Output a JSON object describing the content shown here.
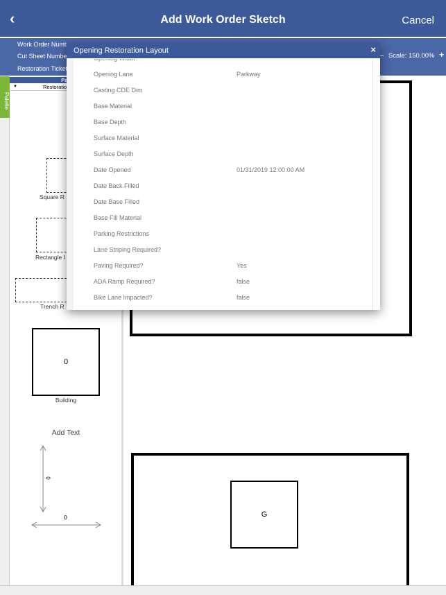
{
  "header": {
    "back_icon": "chevron-left-icon",
    "back": "‹",
    "title": "Add Work Order Sketch",
    "cancel": "Cancel"
  },
  "info": {
    "work_order_label": "Work Order Numb",
    "cut_sheet_label": "Cut Sheet Numbe",
    "restoration_ticket_label": "Restoration Ticket",
    "scale_minus": "–",
    "scale": "Scale: 150.00%",
    "scale_plus": "+"
  },
  "palette": {
    "tab": "Palette",
    "header": "Pale",
    "dropdown": "Restoratio",
    "items": [
      {
        "label": "Square R"
      },
      {
        "label": "Rectangle I"
      },
      {
        "label": "Trench R"
      },
      {
        "label": "Building",
        "value": "0"
      }
    ],
    "add_text": "Add Text",
    "vertical_dim": "0",
    "horizontal_dim": "0"
  },
  "canvas": {
    "inner_label": "G"
  },
  "dialog": {
    "title": "Opening Restoration Layout",
    "close": "×",
    "rows": [
      {
        "label": "Opening Width",
        "value": ""
      },
      {
        "label": "Opening Lane",
        "value": "Parkway"
      },
      {
        "label": "Casting CDE Dim",
        "value": ""
      },
      {
        "label": "Base Material",
        "value": ""
      },
      {
        "label": "Base Depth",
        "value": ""
      },
      {
        "label": "Surface Material",
        "value": ""
      },
      {
        "label": "Surface Depth",
        "value": ""
      },
      {
        "label": "Date Opened",
        "value": "01/31/2019 12:00:00 AM"
      },
      {
        "label": "Date Back Filled",
        "value": ""
      },
      {
        "label": "Date Base Filled",
        "value": ""
      },
      {
        "label": "Base Fill Material",
        "value": ""
      },
      {
        "label": "Parking Restrictions",
        "value": ""
      },
      {
        "label": "Lane Striping Required?",
        "value": ""
      },
      {
        "label": "Paving Required?",
        "value": "Yes"
      },
      {
        "label": "ADA Ramp Required?",
        "value": "false"
      },
      {
        "label": "Bike Lane Impacted?",
        "value": "false"
      }
    ]
  }
}
